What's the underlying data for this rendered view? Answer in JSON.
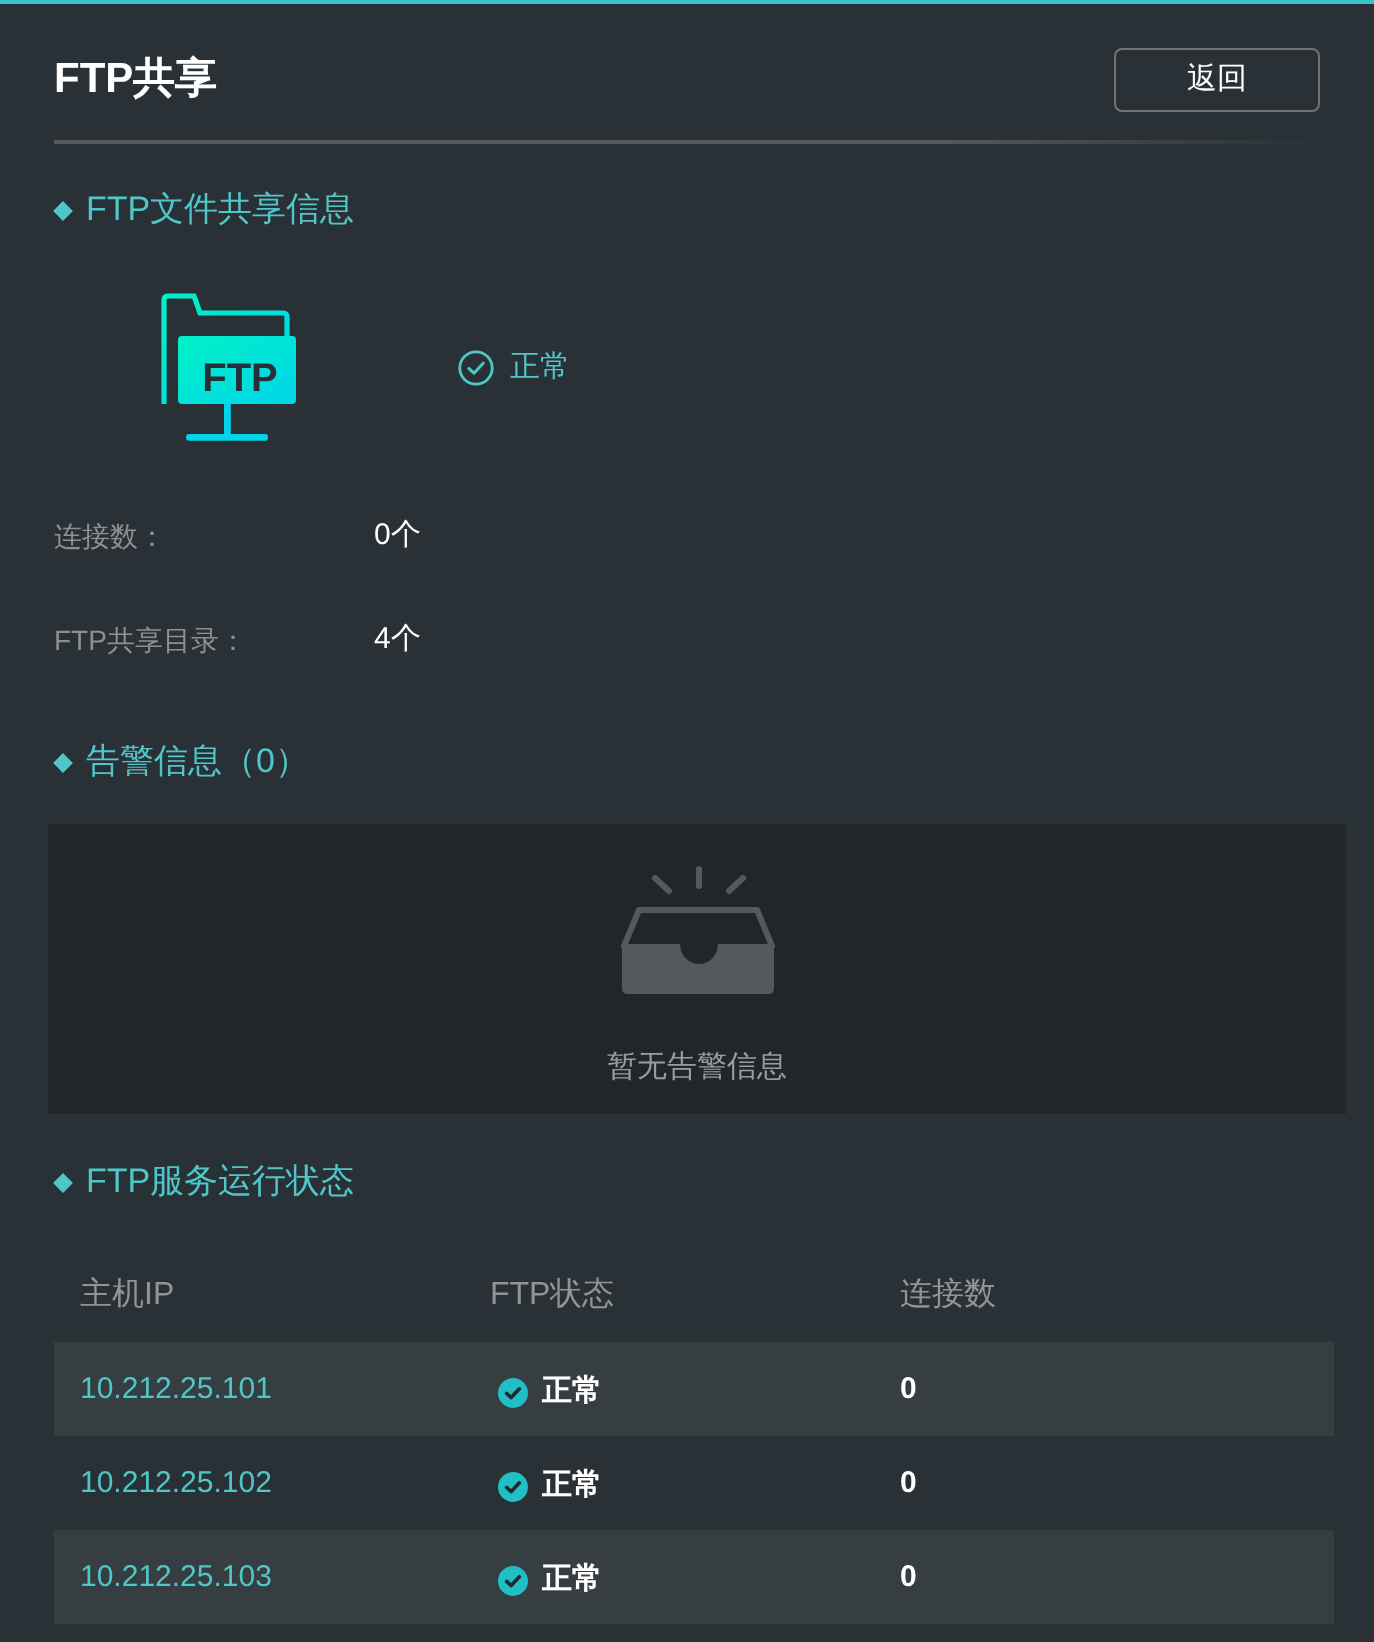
{
  "page": {
    "title": "FTP共享",
    "back_button": "返回"
  },
  "ftp_info": {
    "heading": "FTP文件共享信息",
    "icon_text": "FTP",
    "status": {
      "kind": "normal",
      "label": "正常"
    },
    "fields": [
      {
        "label": "连接数：",
        "value": "0个"
      },
      {
        "label": "FTP共享目录：",
        "value": "4个"
      }
    ]
  },
  "alarms": {
    "heading": "告警信息（0）",
    "empty_text": "暂无告警信息"
  },
  "service_status": {
    "heading": "FTP服务运行状态",
    "table": {
      "columns": [
        "主机IP",
        "FTP状态",
        "连接数"
      ],
      "rows": [
        {
          "host_ip": "10.212.25.101",
          "status": {
            "kind": "normal",
            "label": "正常"
          },
          "connections": "0"
        },
        {
          "host_ip": "10.212.25.102",
          "status": {
            "kind": "normal",
            "label": "正常"
          },
          "connections": "0"
        },
        {
          "host_ip": "10.212.25.103",
          "status": {
            "kind": "normal",
            "label": "正常"
          },
          "connections": "0"
        }
      ]
    }
  }
}
